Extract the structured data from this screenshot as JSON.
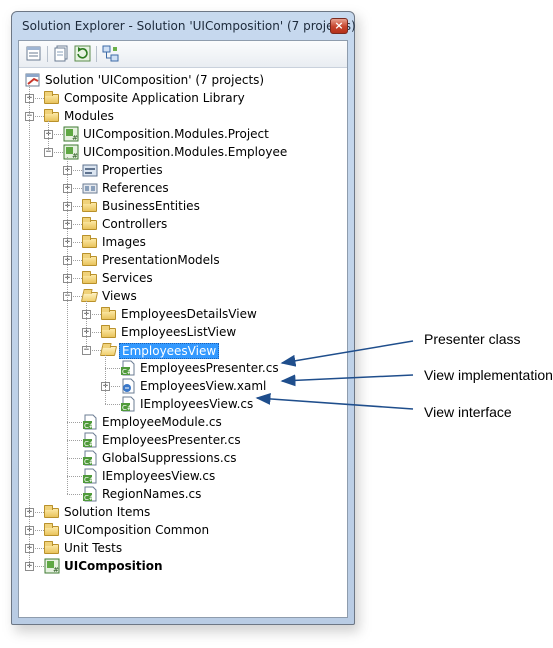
{
  "window": {
    "title": "Solution Explorer - Solution 'UIComposition' (7 projects)",
    "close_glyph": "×"
  },
  "tree": [
    {
      "label": "Solution 'UIComposition' (7 projects)",
      "icon": "solution-icon",
      "level": 0,
      "expander": "none"
    },
    {
      "label": "Composite Application Library",
      "icon": "folder-icon",
      "level": 1,
      "expander": "+"
    },
    {
      "label": "Modules",
      "icon": "folder-icon",
      "level": 1,
      "expander": "-"
    },
    {
      "label": "UIComposition.Modules.Project",
      "icon": "csharp-project-icon",
      "level": 2,
      "expander": "+"
    },
    {
      "label": "UIComposition.Modules.Employee",
      "icon": "csharp-project-icon",
      "level": 2,
      "expander": "-"
    },
    {
      "label": "Properties",
      "icon": "properties-icon",
      "level": 3,
      "expander": "+"
    },
    {
      "label": "References",
      "icon": "references-icon",
      "level": 3,
      "expander": "+"
    },
    {
      "label": "BusinessEntities",
      "icon": "folder-icon",
      "level": 3,
      "expander": "+"
    },
    {
      "label": "Controllers",
      "icon": "folder-icon",
      "level": 3,
      "expander": "+"
    },
    {
      "label": "Images",
      "icon": "folder-icon",
      "level": 3,
      "expander": "+"
    },
    {
      "label": "PresentationModels",
      "icon": "folder-icon",
      "level": 3,
      "expander": "+"
    },
    {
      "label": "Services",
      "icon": "folder-icon",
      "level": 3,
      "expander": "+"
    },
    {
      "label": "Views",
      "icon": "open-folder-icon",
      "level": 3,
      "expander": "-"
    },
    {
      "label": "EmployeesDetailsView",
      "icon": "folder-icon",
      "level": 4,
      "expander": "+"
    },
    {
      "label": "EmployeesListView",
      "icon": "folder-icon",
      "level": 4,
      "expander": "+"
    },
    {
      "label": "EmployeesView",
      "icon": "open-folder-icon",
      "level": 4,
      "expander": "-",
      "selected": true
    },
    {
      "label": "EmployeesPresenter.cs",
      "icon": "csharp-file-icon",
      "level": 5,
      "expander": "none"
    },
    {
      "label": "EmployeesView.xaml",
      "icon": "xaml-file-icon",
      "level": 5,
      "expander": "+"
    },
    {
      "label": "IEmployeesView.cs",
      "icon": "csharp-file-icon",
      "level": 5,
      "expander": "none"
    },
    {
      "label": "EmployeeModule.cs",
      "icon": "csharp-file-icon",
      "level": 3,
      "expander": "none"
    },
    {
      "label": "EmployeesPresenter.cs",
      "icon": "csharp-file-icon",
      "level": 3,
      "expander": "none"
    },
    {
      "label": "GlobalSuppressions.cs",
      "icon": "csharp-file-icon",
      "level": 3,
      "expander": "none"
    },
    {
      "label": "IEmployeesView.cs",
      "icon": "csharp-file-icon",
      "level": 3,
      "expander": "none"
    },
    {
      "label": "RegionNames.cs",
      "icon": "csharp-file-icon",
      "level": 3,
      "expander": "none"
    },
    {
      "label": "Solution Items",
      "icon": "folder-icon",
      "level": 1,
      "expander": "+"
    },
    {
      "label": "UIComposition Common",
      "icon": "folder-icon",
      "level": 1,
      "expander": "+"
    },
    {
      "label": "Unit Tests",
      "icon": "folder-icon",
      "level": 1,
      "expander": "+"
    },
    {
      "label": "UIComposition",
      "icon": "csharp-project-icon",
      "level": 1,
      "expander": "+",
      "bold": true
    }
  ],
  "callouts": {
    "presenter": "Presenter class",
    "view_impl": "View implementation",
    "view_iface": "View interface"
  },
  "toolbar": [
    "properties-icon",
    "show-all-files-icon",
    "refresh-icon",
    "class-diagram-icon"
  ],
  "colors": {
    "selection": "#3399ff",
    "arrow": "#1f4e8c",
    "titlebar": "#c7d9ee"
  }
}
